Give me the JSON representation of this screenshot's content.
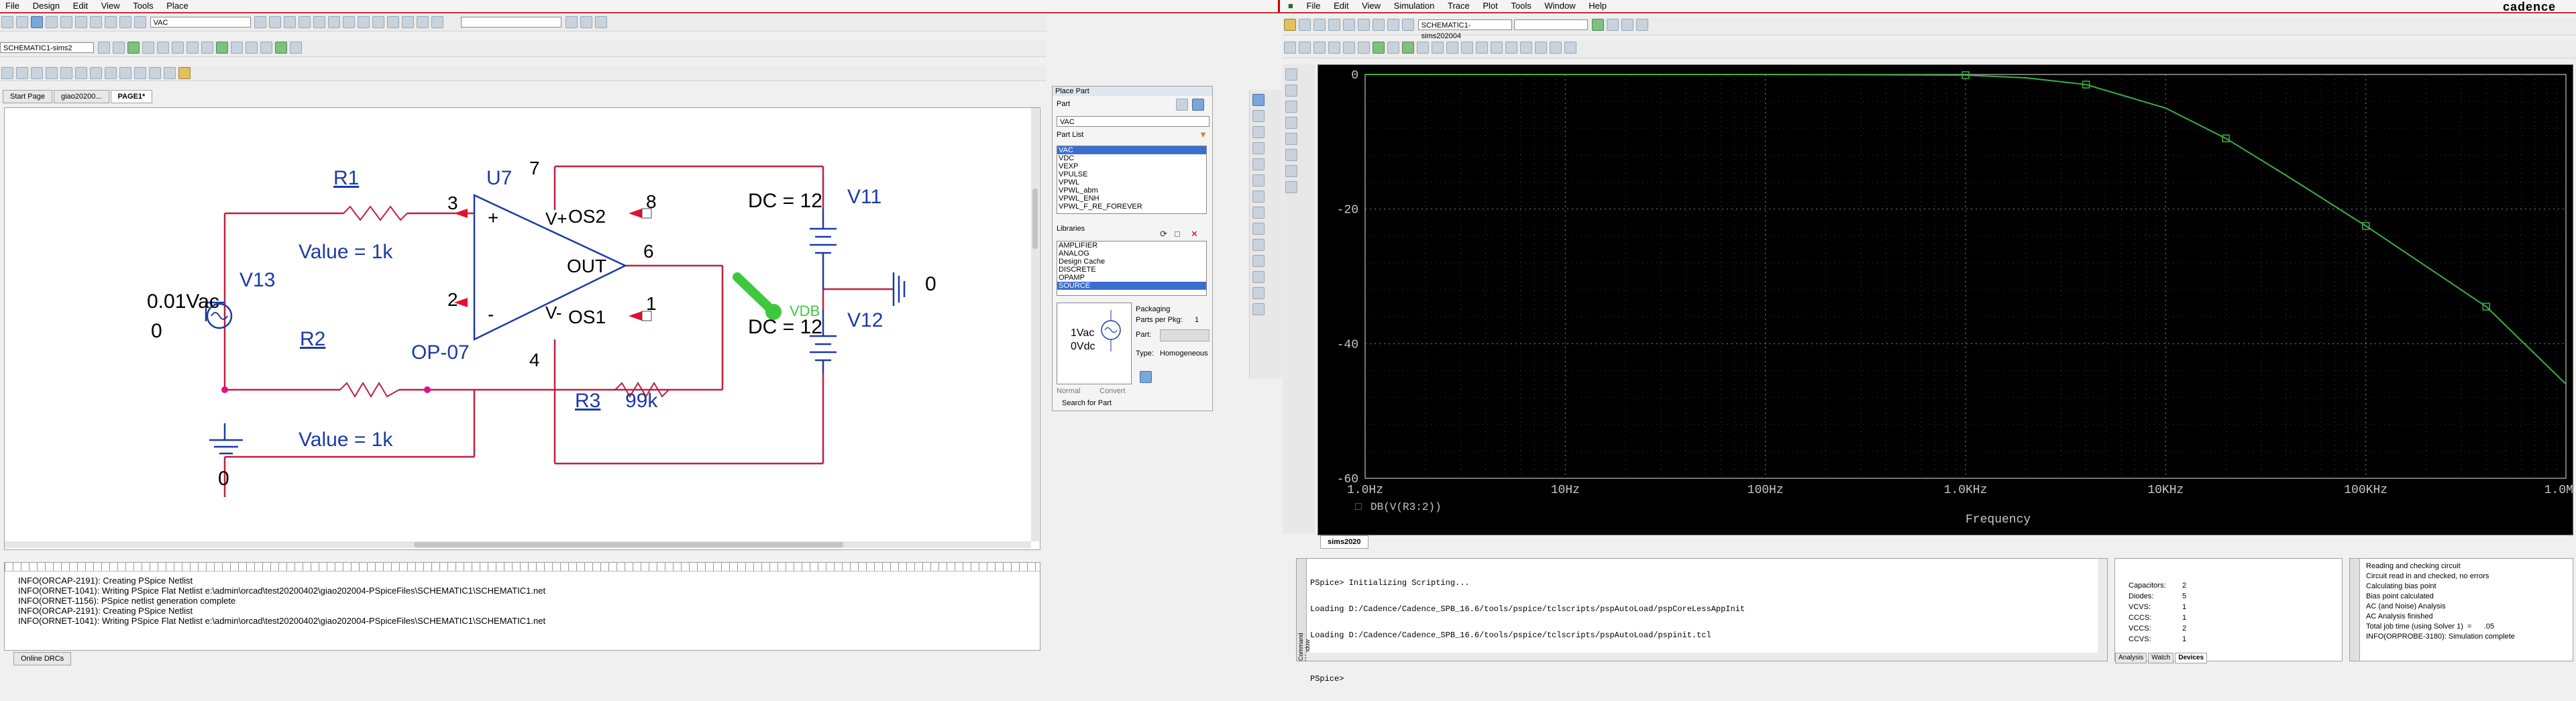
{
  "left_app": {
    "menu": [
      "File",
      "Design",
      "Edit",
      "View",
      "Tools",
      "Place"
    ],
    "toolbar": {
      "part_combo": "VAC",
      "search_combo": ""
    },
    "toolbar2": {
      "schematic_combo": "SCHEMATIC1-sims2"
    },
    "tabs": [
      "Start Page",
      "giao20200...",
      "PAGE1*"
    ],
    "schematic": {
      "components": {
        "r1": "R1",
        "r1_value": "Value = 1k",
        "r2": "R2",
        "r2_value": "Value = 1k",
        "r3": "R3",
        "r3_value": "99k",
        "u7": "U7",
        "u7_model": "OP-07",
        "v13": "V13",
        "v13_value": "0.01Vac",
        "v13_dc": "0",
        "v11": "V11",
        "v11_dc": "DC = 12",
        "v12": "V12",
        "v12_dc": "DC = 12",
        "gnd_label": "0",
        "gnd_label2": "0",
        "vdb_marker": "VDB"
      },
      "pins": {
        "p3": "3",
        "p2": "2",
        "p7": "7",
        "p4": "4",
        "p6": "6",
        "p8": "8",
        "p1": "1",
        "plus": "+",
        "minus": "-",
        "vplus": "V+",
        "vminus": "V-",
        "os2": "OS2",
        "os1": "OS1",
        "out": "OUT"
      }
    },
    "log": [
      "INFO(ORCAP-2191): Creating PSpice Netlist",
      "INFO(ORNET-1041): Writing PSpice Flat Netlist e:\\admin\\orcad\\test20200402\\giao202004-PSpiceFiles\\SCHEMATIC1\\SCHEMATIC1.net",
      "INFO(ORNET-1156): PSpice netlist generation complete",
      "INFO(ORCAP-2191): Creating PSpice Netlist",
      "INFO(ORNET-1041): Writing PSpice Flat Netlist e:\\admin\\orcad\\test20200402\\giao202004-PSpiceFiles\\SCHEMATIC1\\SCHEMATIC1.net"
    ],
    "bottom_tab": "Online DRCs"
  },
  "place_part": {
    "title": "Place Part",
    "part_label": "Part",
    "part_value": "VAC",
    "part_list_label": "Part List",
    "part_list": [
      "VAC",
      "VDC",
      "VEXP",
      "VPULSE",
      "VPWL",
      "VPWL_abm",
      "VPWL_ENH",
      "VPWL_F_RE_FOREVER"
    ],
    "selected_part": "VAC",
    "libraries_label": "Libraries",
    "libraries": [
      "AMPLIFIER",
      "ANALOG",
      "Design Cache",
      "DISCRETE",
      "OPAMP",
      "SOURCE"
    ],
    "selected_library": "SOURCE",
    "packaging_label": "Packaging",
    "parts_per_pkg_label": "Parts per Pkg:",
    "parts_per_pkg": "1",
    "part_label2": "Part:",
    "type_label": "Type:",
    "type_value": "Homogeneous",
    "preview_line1": "1Vac",
    "preview_line2": "0Vdc",
    "normal_label": "Normal",
    "convert_label": "Convert",
    "search_label": "Search for Part"
  },
  "right_app": {
    "menu": [
      "File",
      "Edit",
      "View",
      "Simulation",
      "Trace",
      "Plot",
      "Tools",
      "Window",
      "Help"
    ],
    "brand": "cadence",
    "profile_combo": "SCHEMATIC1-sims202004",
    "plot_tab": "sims2020",
    "trace_legend": "DB(V(R3:2))",
    "x_title": "Frequency",
    "console_lines": [
      "PSpice> Initializing Scripting...",
      "Loading D:/Cadence/Cadence_SPB_16.6/tools/pspice/tclscripts/pspAutoLoad/pspCoreLessAppInit",
      "Loading D:/Cadence/Cadence_SPB_16.6/tools/pspice/tclscripts/pspAutoLoad/pspinit.tcl",
      "",
      "PSpice>"
    ],
    "console_side_label": "Command Window",
    "stats": [
      {
        "k": "Capacitors:",
        "v": "2"
      },
      {
        "k": "Diodes:",
        "v": "5"
      },
      {
        "k": "VCVS:",
        "v": "1"
      },
      {
        "k": "CCCS:",
        "v": "1"
      },
      {
        "k": "VCCS:",
        "v": "2"
      },
      {
        "k": "CCVS:",
        "v": "1"
      }
    ],
    "bottom_tabs": [
      "Analysis",
      "Watch",
      "Devices"
    ],
    "status_lines": [
      "Reading and checking circuit",
      "Circuit read in and checked, no errors",
      "Calculating bias point",
      "Bias point calculated",
      "AC (and Noise) Analysis",
      "AC Analysis finished",
      "Total job time (using Solver 1)  =      .05",
      "INFO(ORPROBE-3180): Simulation complete"
    ]
  },
  "chart_data": {
    "type": "line",
    "title": "",
    "xlabel": "Frequency",
    "ylabel": "",
    "x_scale": "log",
    "x_ticks": [
      "1.0Hz",
      "10Hz",
      "100Hz",
      "1.0KHz",
      "10KHz",
      "100KHz",
      "1.0MHz"
    ],
    "y_ticks": [
      "0",
      "-20",
      "-40",
      "-60"
    ],
    "xlim": [
      1,
      1000000
    ],
    "ylim": [
      -60,
      0
    ],
    "grid": true,
    "legend_position": "bottom-left",
    "series": [
      {
        "name": "DB(V(R3:2))",
        "color": "#3cb043",
        "x": [
          1,
          10,
          100,
          1000,
          2000,
          4000,
          10000,
          20000,
          40000,
          100000,
          200000,
          400000,
          1000000
        ],
        "y": [
          0,
          0,
          0,
          -0.1,
          -0.5,
          -1.5,
          -5,
          -9.5,
          -15,
          -22.5,
          -28.5,
          -34.5,
          -46
        ]
      }
    ]
  }
}
